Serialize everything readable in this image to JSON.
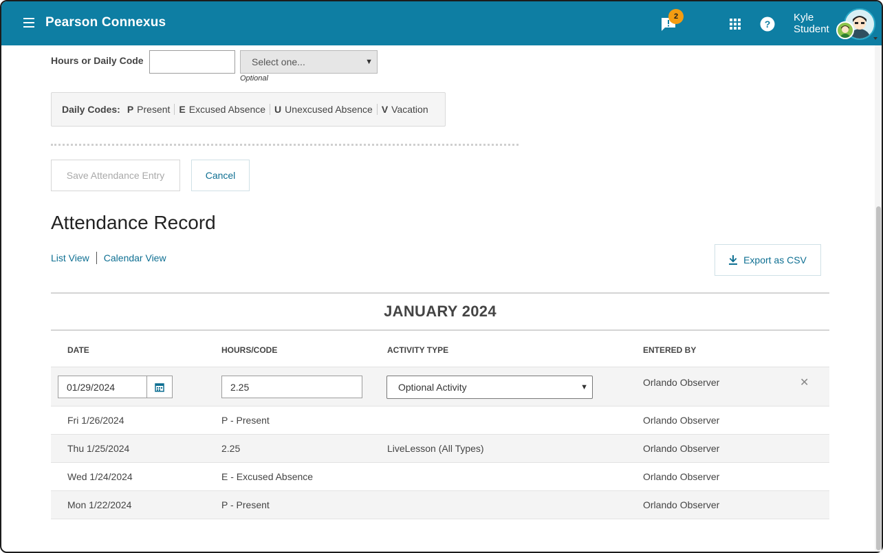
{
  "header": {
    "brand": "Pearson Connexus",
    "notification_count": "2",
    "user_first": "Kyle",
    "user_last": "Student",
    "accent_color": "#0e7ea3",
    "badge_color": "#f39c12"
  },
  "form": {
    "hours_label": "Hours or Daily Code",
    "hours_value": "",
    "select_placeholder": "Select one...",
    "optional_note": "Optional",
    "daily_codes_label": "Daily Codes:",
    "daily_codes": [
      {
        "code": "P",
        "label": "Present"
      },
      {
        "code": "E",
        "label": "Excused Absence"
      },
      {
        "code": "U",
        "label": "Unexcused Absence"
      },
      {
        "code": "V",
        "label": "Vacation"
      }
    ],
    "save_label": "Save Attendance Entry",
    "cancel_label": "Cancel"
  },
  "record": {
    "title": "Attendance Record",
    "list_view": "List View",
    "calendar_view": "Calendar View",
    "export_label": "Export as CSV",
    "month": "JANUARY 2024",
    "columns": [
      "DATE",
      "HOURS/CODE",
      "ACTIVITY TYPE",
      "ENTERED BY"
    ],
    "edit_row": {
      "date": "01/29/2024",
      "hours": "2.25",
      "activity": "Optional Activity",
      "entered_by": "Orlando Observer"
    },
    "rows": [
      {
        "date": "Fri 1/26/2024",
        "code": "P - Present",
        "activity": "",
        "entered_by": "Orlando Observer"
      },
      {
        "date": "Thu 1/25/2024",
        "code": "2.25",
        "activity": "LiveLesson (All Types)",
        "entered_by": "Orlando Observer"
      },
      {
        "date": "Wed 1/24/2024",
        "code": "E - Excused Absence",
        "activity": "",
        "entered_by": "Orlando Observer"
      },
      {
        "date": "Mon 1/22/2024",
        "code": "P - Present",
        "activity": "",
        "entered_by": "Orlando Observer"
      }
    ]
  }
}
